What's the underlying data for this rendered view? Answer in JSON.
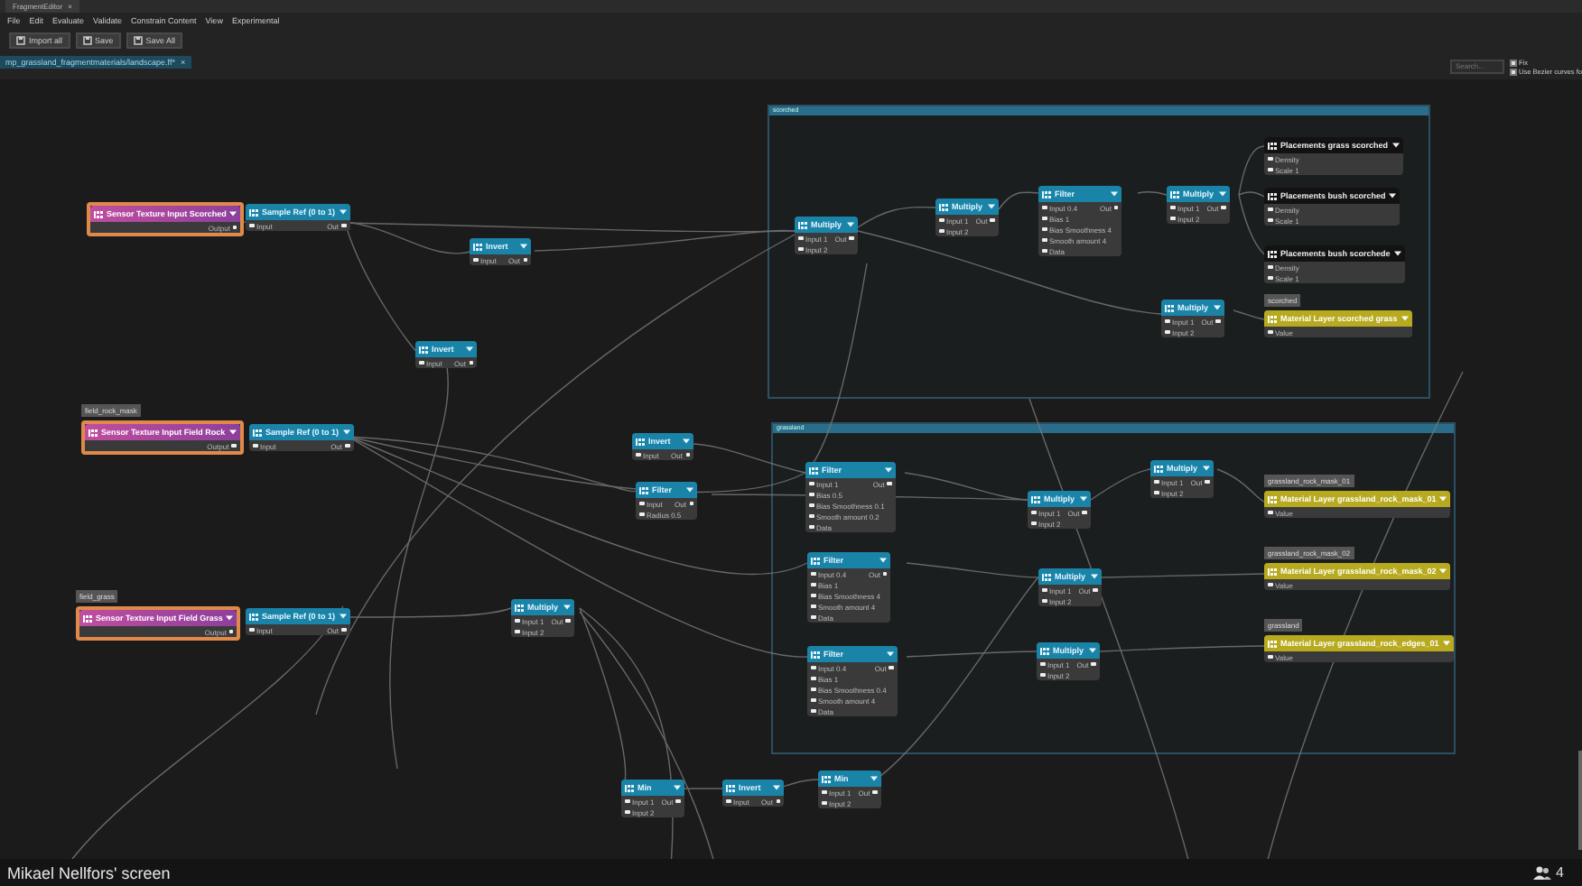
{
  "window": {
    "tab": "FragmentEditor",
    "close": "×"
  },
  "menu": [
    "File",
    "Edit",
    "Evaluate",
    "Validate",
    "Constrain Content",
    "View",
    "Experimental"
  ],
  "toolbar": [
    "Import all",
    "Save",
    "Save All"
  ],
  "document_tab": {
    "title": "mp_grassland_fragmentmaterials/landscape.ff*",
    "close": "×"
  },
  "search": {
    "placeholder": "Search..."
  },
  "options": [
    {
      "label": "Fix",
      "checked": true
    },
    {
      "label": "Use Bezier curves fo",
      "checked": true
    }
  ],
  "groups": [
    {
      "title": "scorched"
    },
    {
      "title": "grassland"
    }
  ],
  "nodes": [
    {
      "kind": "sensor",
      "title": "Sensor Texture Input Scorched",
      "ports": [
        {
          "out": "Output"
        }
      ]
    },
    {
      "kind": "op",
      "title": "Sample Ref (0 to 1)",
      "ports": [
        {
          "in": "Input",
          "out": "Out"
        }
      ]
    },
    {
      "kind": "op",
      "title": "Invert",
      "ports": [
        {
          "in": "Input",
          "out": "Out"
        }
      ]
    },
    {
      "kind": "op",
      "title": "Invert",
      "ports": [
        {
          "in": "Input",
          "out": "Out"
        }
      ]
    },
    {
      "kind": "sensor",
      "tag": "field_rock_mask",
      "title": "Sensor Texture Input Field Rock",
      "ports": [
        {
          "out": "Output"
        }
      ]
    },
    {
      "kind": "op",
      "title": "Sample Ref (0 to 1)",
      "ports": [
        {
          "in": "Input",
          "out": "Out"
        }
      ]
    },
    {
      "kind": "sensor",
      "tag": "field_grass",
      "title": "Sensor Texture Input Field Grass",
      "ports": [
        {
          "out": "Output"
        }
      ]
    },
    {
      "kind": "op",
      "title": "Sample Ref (0 to 1)",
      "ports": [
        {
          "in": "Input",
          "out": "Out"
        }
      ]
    },
    {
      "kind": "op",
      "title": "Invert",
      "ports": [
        {
          "in": "Input",
          "out": "Out"
        }
      ]
    },
    {
      "kind": "op",
      "title": "Filter",
      "ports": [
        {
          "in": "Input",
          "out": "Out"
        },
        {
          "in": "Radius 0.5"
        }
      ]
    },
    {
      "kind": "op",
      "title": "Multiply",
      "ports": [
        {
          "in": "Input 1",
          "out": "Out"
        },
        {
          "in": "Input 2"
        }
      ]
    },
    {
      "kind": "op",
      "title": "Min",
      "ports": [
        {
          "in": "Input 1",
          "out": "Out"
        },
        {
          "in": "Input 2"
        }
      ]
    },
    {
      "kind": "op",
      "title": "Invert",
      "ports": [
        {
          "in": "Input",
          "out": "Out"
        }
      ]
    },
    {
      "kind": "op",
      "title": "Min",
      "ports": [
        {
          "in": "Input 1",
          "out": "Out"
        },
        {
          "in": "Input 2"
        }
      ]
    },
    {
      "kind": "op",
      "title": "Multiply",
      "ports": [
        {
          "in": "Input 1",
          "out": "Out"
        },
        {
          "in": "Input 2"
        }
      ]
    },
    {
      "kind": "op",
      "title": "Multiply",
      "ports": [
        {
          "in": "Input 1",
          "out": "Out"
        },
        {
          "in": "Input 2"
        }
      ]
    },
    {
      "kind": "op",
      "title": "Filter",
      "ports": [
        {
          "in": "Input 0.4",
          "out": "Out"
        },
        {
          "in": "Bias 1"
        },
        {
          "in": "Bias Smoothness 4"
        },
        {
          "in": "Smooth amount 4"
        },
        {
          "in": "Data"
        }
      ]
    },
    {
      "kind": "op",
      "title": "Multiply",
      "ports": [
        {
          "in": "Input 1",
          "out": "Out"
        },
        {
          "in": "Input 2"
        }
      ]
    },
    {
      "kind": "placement",
      "title": "Placements grass scorched",
      "ports": [
        {
          "in": "Density"
        },
        {
          "in": "Scale 1"
        }
      ]
    },
    {
      "kind": "placement",
      "title": "Placements bush scorched",
      "ports": [
        {
          "in": "Density"
        },
        {
          "in": "Scale 1"
        }
      ]
    },
    {
      "kind": "placement",
      "title": "Placements bush scorchede",
      "ports": [
        {
          "in": "Density"
        },
        {
          "in": "Scale 1"
        }
      ]
    },
    {
      "kind": "op",
      "title": "Multiply",
      "ports": [
        {
          "in": "Input 1",
          "out": "Out"
        },
        {
          "in": "Input 2"
        }
      ]
    },
    {
      "kind": "material",
      "tag": "scorched",
      "title": "Material Layer scorched grass",
      "ports": [
        {
          "in": "Value"
        }
      ]
    },
    {
      "kind": "op",
      "title": "Filter",
      "ports": [
        {
          "in": "Input 1",
          "out": "Out"
        },
        {
          "in": "Bias 0.5"
        },
        {
          "in": "Bias Smoothness 0.1"
        },
        {
          "in": "Smooth amount 0.2"
        },
        {
          "in": "Data"
        }
      ]
    },
    {
      "kind": "op",
      "title": "Filter",
      "ports": [
        {
          "in": "Input 0.4",
          "out": "Out"
        },
        {
          "in": "Bias 1"
        },
        {
          "in": "Bias Smoothness 4"
        },
        {
          "in": "Smooth amount 4"
        },
        {
          "in": "Data"
        }
      ]
    },
    {
      "kind": "op",
      "title": "Filter",
      "ports": [
        {
          "in": "Input 0.4",
          "out": "Out"
        },
        {
          "in": "Bias 1"
        },
        {
          "in": "Bias Smoothness 0.4"
        },
        {
          "in": "Smooth amount 4"
        },
        {
          "in": "Data"
        }
      ]
    },
    {
      "kind": "op",
      "title": "Multiply",
      "ports": [
        {
          "in": "Input 1",
          "out": "Out"
        },
        {
          "in": "Input 2"
        }
      ]
    },
    {
      "kind": "op",
      "title": "Multiply",
      "ports": [
        {
          "in": "Input 1",
          "out": "Out"
        },
        {
          "in": "Input 2"
        }
      ]
    },
    {
      "kind": "op",
      "title": "Multiply",
      "ports": [
        {
          "in": "Input 1",
          "out": "Out"
        },
        {
          "in": "Input 2"
        }
      ]
    },
    {
      "kind": "op",
      "title": "Multiply",
      "ports": [
        {
          "in": "Input 1",
          "out": "Out"
        },
        {
          "in": "Input 2"
        }
      ]
    },
    {
      "kind": "material",
      "tag": "grassland_rock_mask_01",
      "title": "Material Layer grassland_rock_mask_01",
      "ports": [
        {
          "in": "Value"
        }
      ]
    },
    {
      "kind": "material",
      "tag": "grassland_rock_mask_02",
      "title": "Material Layer grassland_rock_mask_02",
      "ports": [
        {
          "in": "Value"
        }
      ]
    },
    {
      "kind": "material",
      "tag": "grassland",
      "title": "Material Layer grassland_rock_edges_01",
      "ports": [
        {
          "in": "Value"
        }
      ]
    }
  ],
  "share_bar": {
    "presenter": "Mikael Nellfors' screen",
    "participants": "4"
  }
}
